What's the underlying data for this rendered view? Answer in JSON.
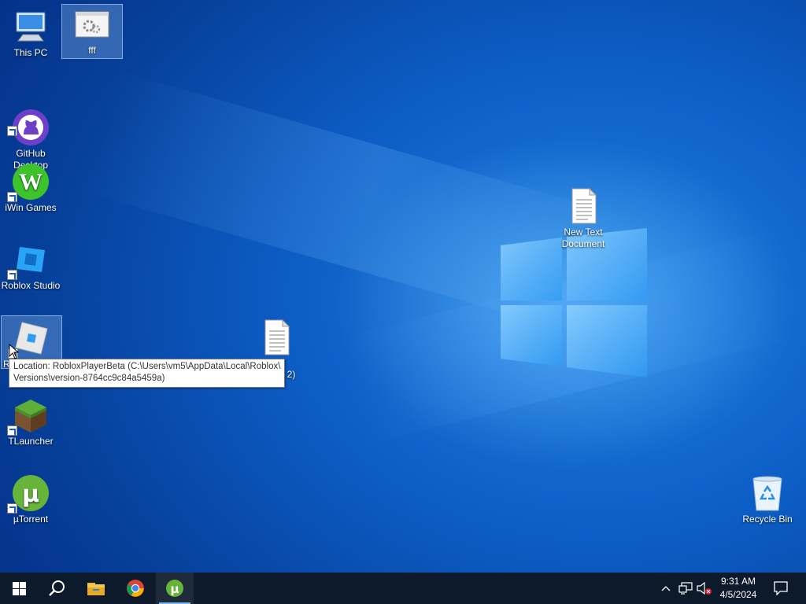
{
  "desktop": {
    "icons": [
      {
        "label": "This PC",
        "icon": "this-pc-icon"
      },
      {
        "label": "fff",
        "icon": "settings-file-icon"
      },
      {
        "label": "GitHub\nDesktop",
        "icon": "github-desktop-icon"
      },
      {
        "label": "iWin Games",
        "icon": "iwin-games-icon"
      },
      {
        "label": "Roblox Studio",
        "icon": "roblox-studio-icon"
      },
      {
        "label": "R",
        "icon": "roblox-player-icon"
      },
      {
        "label": "TLauncher",
        "icon": "tlauncher-icon"
      },
      {
        "label": "µTorrent",
        "icon": "utorrent-icon"
      },
      {
        "label": "New Text\nDocument",
        "icon": "text-document-icon"
      },
      {
        "label": "2)",
        "icon": "text-document-icon"
      },
      {
        "label": "Recycle Bin",
        "icon": "recycle-bin-icon"
      }
    ],
    "tooltip": "Location: RobloxPlayerBeta (C:\\Users\\vm5\\AppData\\Local\\Roblox\\\nVersions\\version-8764cc9c84a5459a)"
  },
  "taskbar": {
    "start": "windows-start-icon",
    "search": "search-icon",
    "pinned": [
      {
        "name": "File Explorer",
        "icon": "file-explorer-icon"
      },
      {
        "name": "Google Chrome",
        "icon": "chrome-icon"
      },
      {
        "name": "µTorrent",
        "icon": "utorrent-icon",
        "running": true
      }
    ],
    "tray": {
      "icons": [
        "show-hidden-icons-chevron",
        "network-icon",
        "volume-muted-icon"
      ],
      "time": "9:31 AM",
      "date": "4/5/2024",
      "notifications": "action-center-icon"
    }
  },
  "colors": {
    "wallpaper_blue": "#0c5cc4",
    "taskbar": "#0c1a2b",
    "running_indicator": "#76b9ed"
  }
}
